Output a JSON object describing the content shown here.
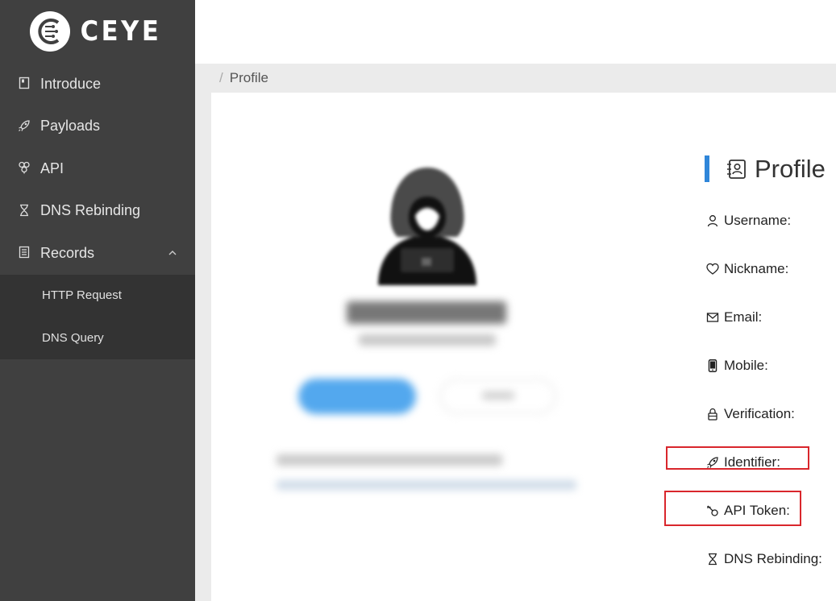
{
  "app": {
    "logo_text": "CEYE"
  },
  "sidebar": {
    "items": [
      {
        "label": "Introduce",
        "icon": "book-icon"
      },
      {
        "label": "Payloads",
        "icon": "rocket-icon"
      },
      {
        "label": "API",
        "icon": "api-icon"
      },
      {
        "label": "DNS Rebinding",
        "icon": "hourglass-icon"
      },
      {
        "label": "Records",
        "icon": "file-icon",
        "expanded": true
      }
    ],
    "subitems": [
      {
        "label": "HTTP Request"
      },
      {
        "label": "DNS Query"
      }
    ]
  },
  "breadcrumb": {
    "separator": "/",
    "current": "Profile"
  },
  "profile": {
    "title": "Profile",
    "fields": [
      {
        "label": "Username:",
        "icon": "user-icon"
      },
      {
        "label": "Nickname:",
        "icon": "heart-icon"
      },
      {
        "label": "Email:",
        "icon": "mail-icon"
      },
      {
        "label": "Mobile:",
        "icon": "phone-icon"
      },
      {
        "label": "Verification:",
        "icon": "lock-icon"
      },
      {
        "label": "Identifier:",
        "icon": "rocket-icon"
      },
      {
        "label": "API Token:",
        "icon": "key-icon"
      },
      {
        "label": "DNS Rebinding:",
        "icon": "hourglass-icon"
      }
    ]
  },
  "colors": {
    "sidebar_bg": "#404040",
    "submenu_bg": "#333333",
    "accent": "#2f86d9",
    "highlight": "#d9262c"
  }
}
